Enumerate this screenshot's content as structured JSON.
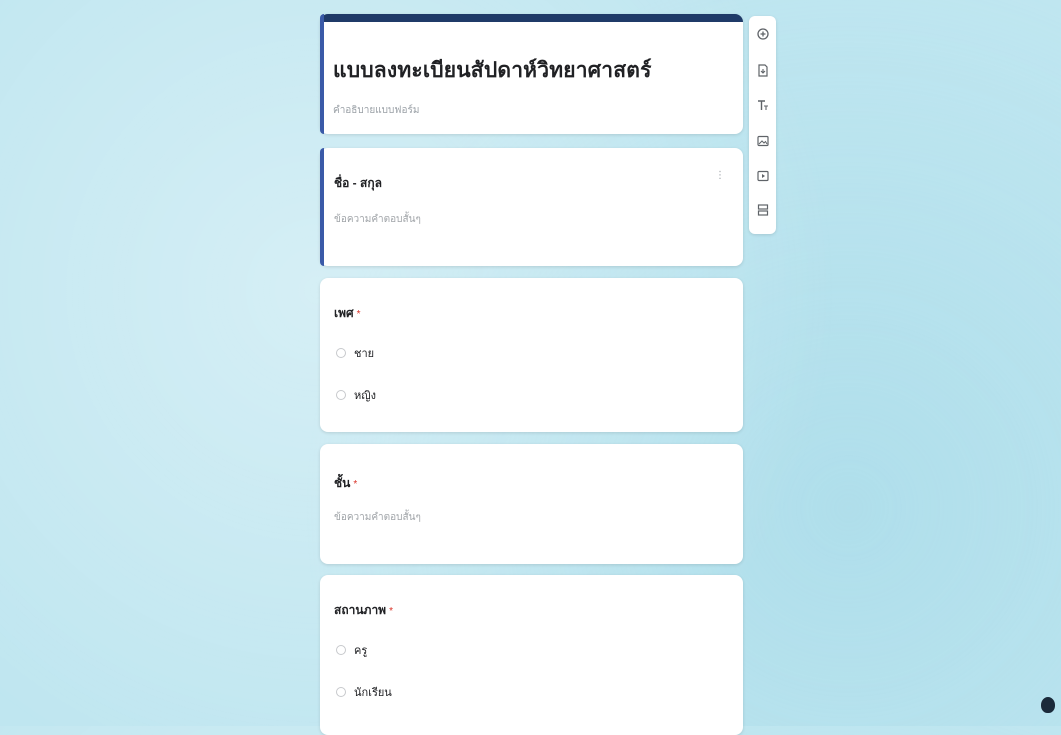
{
  "form": {
    "title": "แบบลงทะเบียนสัปดาห์วิทยาศาสตร์",
    "description": "คำอธิบายแบบฟอร์ม"
  },
  "questions": [
    {
      "label": "ชื่อ - สกุล",
      "hint": "ข้อความคำตอบสั้นๆ",
      "more": "⋮"
    },
    {
      "label": "เพศ",
      "required_mark": "*",
      "options": [
        "ชาย",
        "หญิง"
      ]
    },
    {
      "label": "ชั้น",
      "required_mark": "*",
      "hint": "ข้อความคำตอบสั้นๆ"
    },
    {
      "label": "สถานภาพ",
      "required_mark": "*",
      "options": [
        "ครู",
        "นักเรียน"
      ]
    }
  ],
  "toolbar": {
    "icons": [
      "add-question-icon",
      "import-questions-icon",
      "add-title-icon",
      "add-image-icon",
      "add-video-icon",
      "add-section-icon"
    ]
  },
  "colors": {
    "accent": "#3a5aa8",
    "header_bar": "#1f3a68",
    "background": "#bfe6f0"
  }
}
